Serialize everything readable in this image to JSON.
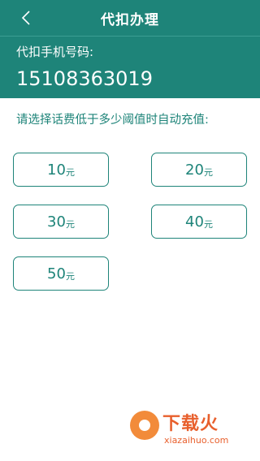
{
  "header": {
    "title": "代扣办理",
    "back_icon": "chevron-left-icon"
  },
  "phone": {
    "label": "代扣手机号码:",
    "number": "15108363019"
  },
  "prompt": "请选择话费低于多少阈值时自动充值:",
  "options": [
    {
      "value": "10",
      "unit": "元"
    },
    {
      "value": "20",
      "unit": "元"
    },
    {
      "value": "30",
      "unit": "元"
    },
    {
      "value": "40",
      "unit": "元"
    },
    {
      "value": "50",
      "unit": "元"
    }
  ],
  "watermark": {
    "brand": "下载火",
    "url": "xiazaihuo.com"
  },
  "colors": {
    "primary": "#1e8479",
    "watermark": "#e85f2c"
  }
}
